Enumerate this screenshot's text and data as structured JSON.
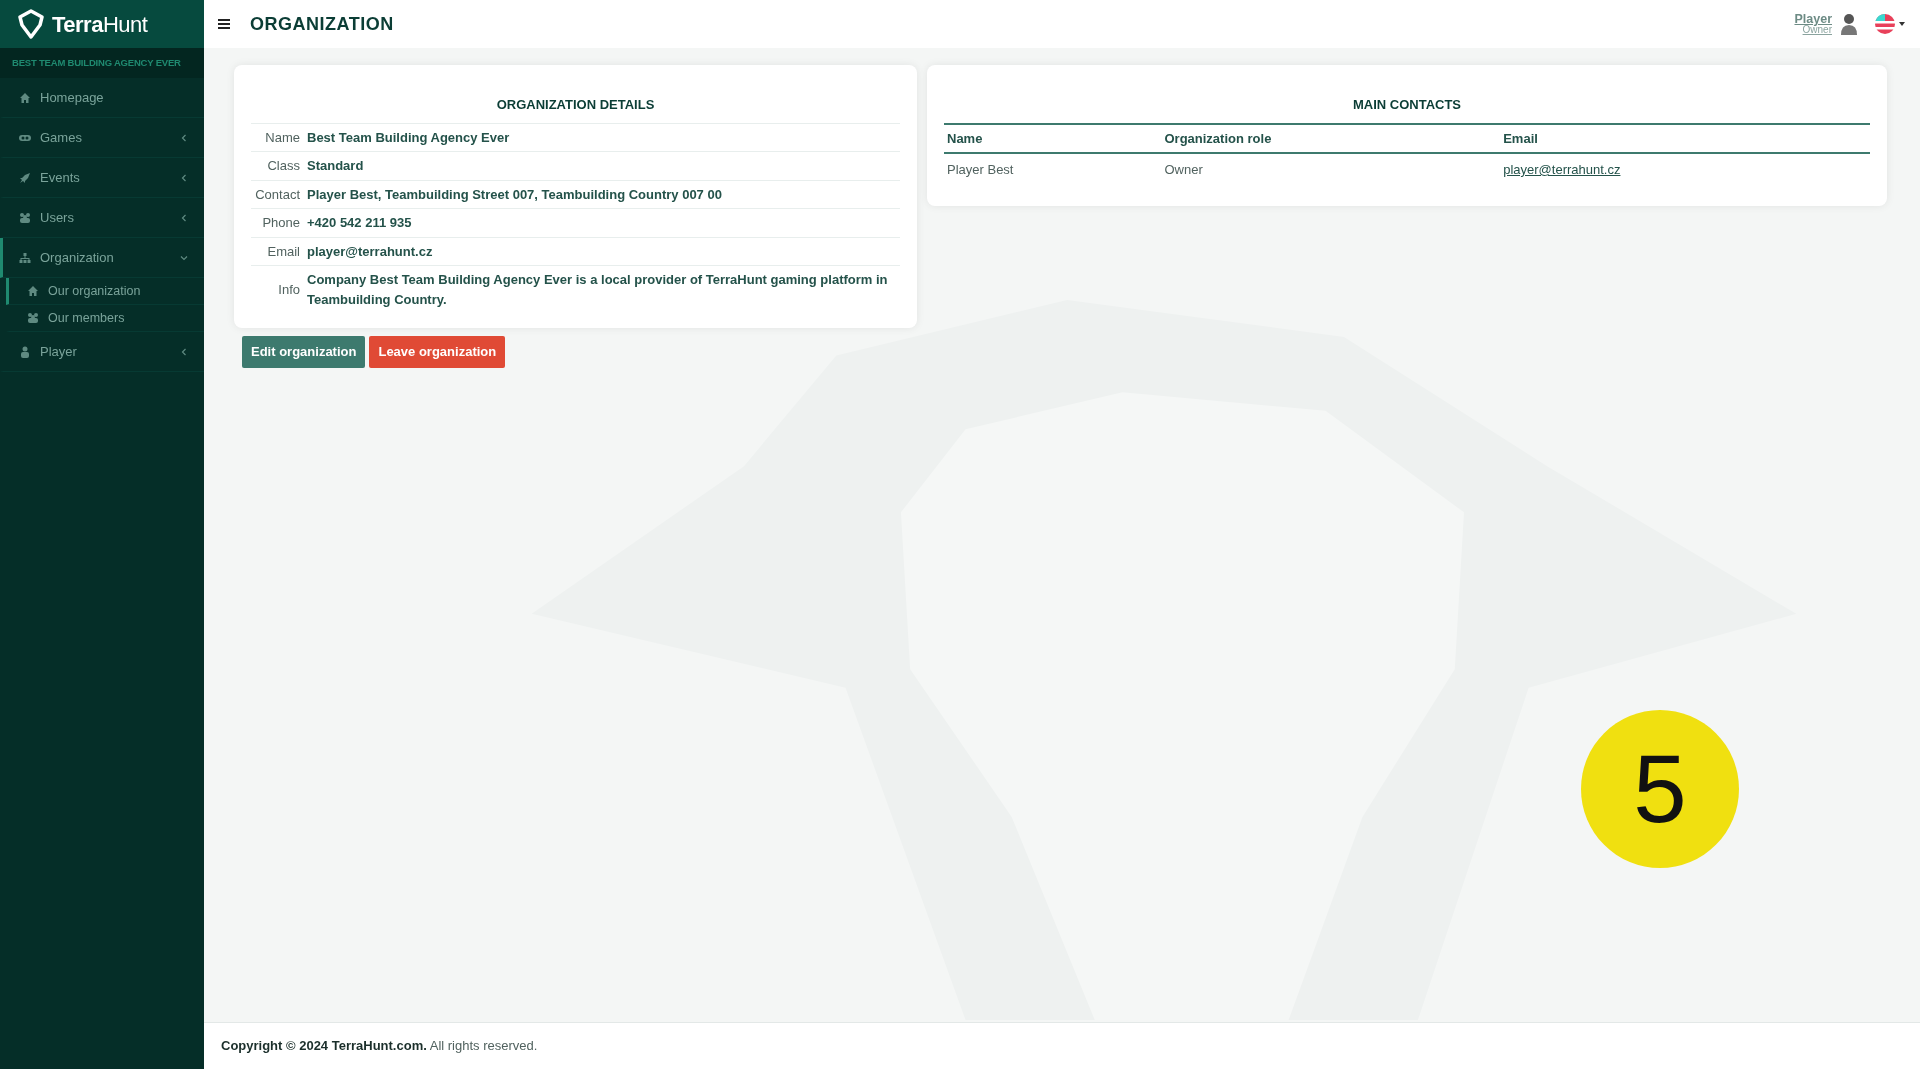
{
  "brand": {
    "strong": "Terra",
    "light": "Hunt"
  },
  "sidebar": {
    "organization_name": "BEST TEAM BUILDING AGENCY EVER",
    "items": [
      {
        "label": "Homepage",
        "selected": false
      },
      {
        "label": "Games",
        "selected": false,
        "expanded": false
      },
      {
        "label": "Events",
        "selected": false,
        "expanded": false
      },
      {
        "label": "Users",
        "selected": false,
        "expanded": false
      },
      {
        "label": "Organization",
        "selected": true,
        "expanded": true,
        "children": [
          {
            "label": "Our organization",
            "selected": true
          },
          {
            "label": "Our members",
            "selected": false
          }
        ]
      },
      {
        "label": "Player",
        "selected": false,
        "expanded": false
      }
    ]
  },
  "header": {
    "title": "ORGANIZATION",
    "user_name": "Player",
    "user_role": "Owner"
  },
  "details": {
    "title": "ORGANIZATION DETAILS",
    "rows": [
      {
        "label": "Name",
        "value": "Best Team Building Agency Ever"
      },
      {
        "label": "Class",
        "value": "Standard"
      },
      {
        "label": "Contact",
        "value": "Player Best, Teambuilding Street 007, Teambuilding Country 007 00"
      },
      {
        "label": "Phone",
        "value": "+420 542 211 935"
      },
      {
        "label": "Email",
        "value": "player@terrahunt.cz"
      },
      {
        "label": "Info",
        "value": "Company Best Team Building Agency Ever is a local provider of TerraHunt gaming platform in Teambuilding Country."
      }
    ]
  },
  "buttons": [
    {
      "label": "Edit organization",
      "kind": "primary"
    },
    {
      "label": "Leave organization",
      "kind": "danger"
    }
  ],
  "contacts": {
    "title": "MAIN CONTACTS",
    "columns": [
      "Name",
      "Organization role",
      "Email"
    ],
    "rows": [
      [
        "Player Best",
        "Owner",
        "player@terrahunt.cz"
      ]
    ]
  },
  "step_marker": "5",
  "footer": "**Copyright © 2024 TerraHunt.com.** All rights reserved."
}
